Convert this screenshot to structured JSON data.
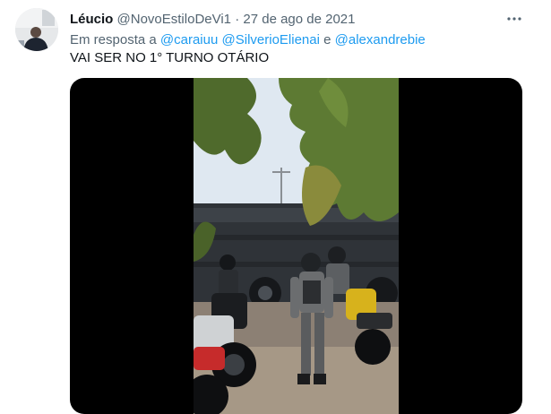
{
  "tweet": {
    "author_name": "Léucio",
    "author_handle": "@NovoEstiloDeVi1",
    "separator": "·",
    "date": "27 de ago de 2021",
    "reply_prefix": "Em resposta a",
    "mentions": [
      "@caraiuu",
      "@SilverioElienai",
      "@alexandrebie"
    ],
    "reply_joiner": "e",
    "text": "VAI SER NO 1° TURNO OTÁRIO",
    "more_icon": "more-horizontal-icon"
  },
  "media": {
    "type": "video",
    "background": "#000000"
  },
  "colors": {
    "link": "#1d9bf0",
    "secondary_text": "#536471",
    "primary_text": "#0f1419"
  }
}
